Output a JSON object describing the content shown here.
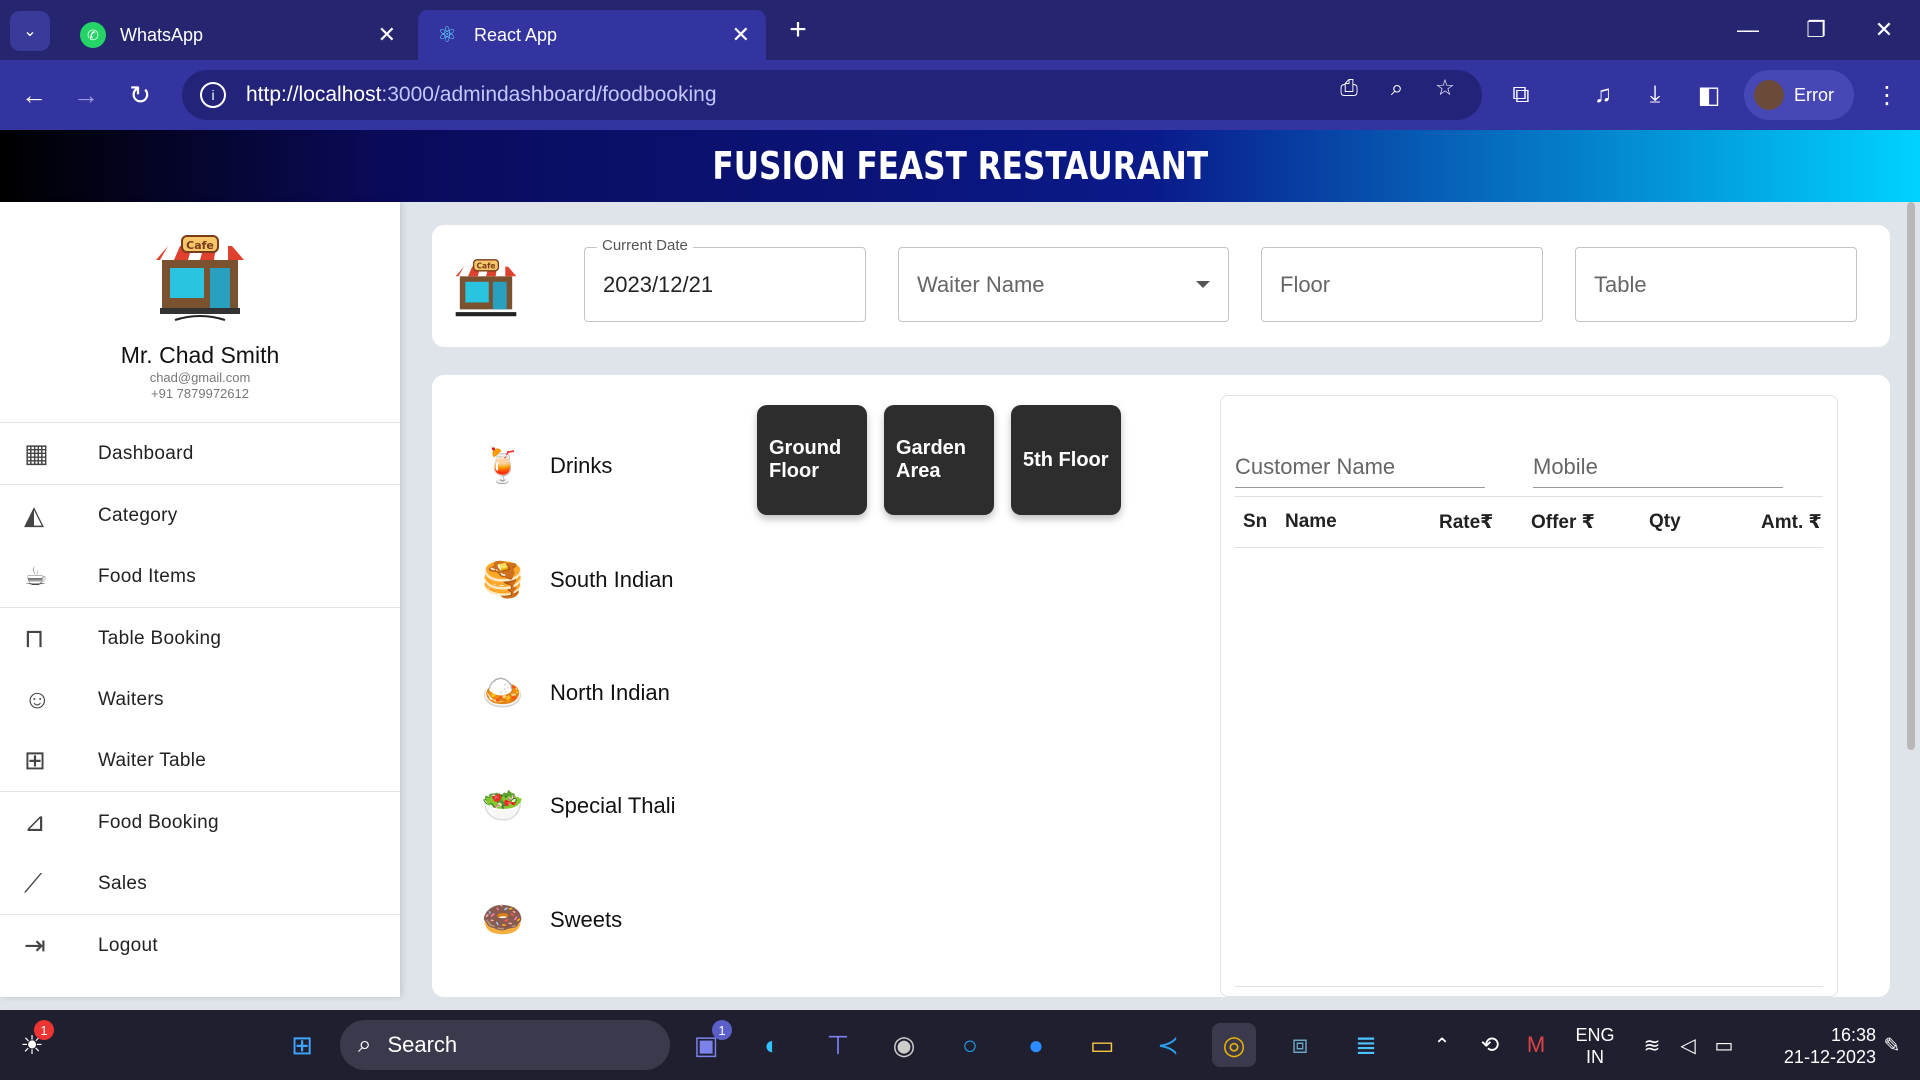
{
  "browser": {
    "tabs": [
      {
        "title": "WhatsApp",
        "icon": "whatsapp-icon"
      },
      {
        "title": "React App",
        "icon": "react-icon"
      }
    ],
    "url_host": "http://localhost",
    "url_path": ":3000/admindashboard/foodbooking",
    "profile_label": "Error"
  },
  "header": {
    "title": "FUSION FEAST RESTAURANT"
  },
  "sidebar": {
    "user_name": "Mr. Chad Smith",
    "user_email": "chad@gmail.com",
    "user_phone": "+91 7879972612",
    "logo_text": "Cafe",
    "items": [
      {
        "label": "Dashboard",
        "icon": "dashboard-icon"
      },
      {
        "label": "Category",
        "icon": "category-icon"
      },
      {
        "label": "Food Items",
        "icon": "food-items-icon"
      },
      {
        "label": "Table Booking",
        "icon": "table-icon"
      },
      {
        "label": "Waiters",
        "icon": "waiter-icon"
      },
      {
        "label": "Waiter Table",
        "icon": "waiter-table-icon"
      },
      {
        "label": "Food Booking",
        "icon": "food-booking-icon"
      },
      {
        "label": "Sales",
        "icon": "sales-chart-icon"
      },
      {
        "label": "Logout",
        "icon": "logout-icon"
      }
    ]
  },
  "booking_form": {
    "date_label": "Current Date",
    "date_value": "2023/12/21",
    "waiter_placeholder": "Waiter Name",
    "floor_placeholder": "Floor",
    "table_placeholder": "Table"
  },
  "categories": [
    {
      "label": "Drinks",
      "icon": "drink-icon"
    },
    {
      "label": "South Indian",
      "icon": "dosa-icon"
    },
    {
      "label": "North Indian",
      "icon": "north-indian-icon"
    },
    {
      "label": "Special Thali",
      "icon": "thali-icon"
    },
    {
      "label": "Sweets",
      "icon": "donut-icon"
    }
  ],
  "floors": [
    {
      "line1": "Ground",
      "line2": "Floor"
    },
    {
      "line1": "Garden",
      "line2": "Area"
    },
    {
      "line1": "5th Floor",
      "line2": ""
    }
  ],
  "order": {
    "customer_placeholder": "Customer Name",
    "mobile_placeholder": "Mobile",
    "columns": [
      "Sn",
      "Name",
      "Rate₹",
      "Offer ₹",
      "Qty",
      "Amt. ₹"
    ]
  },
  "taskbar": {
    "search_label": "Search",
    "lang_line1": "ENG",
    "lang_line2": "IN",
    "time": "16:38",
    "date": "21-12-2023",
    "weather_badge": "1",
    "teams_badge": "1"
  }
}
